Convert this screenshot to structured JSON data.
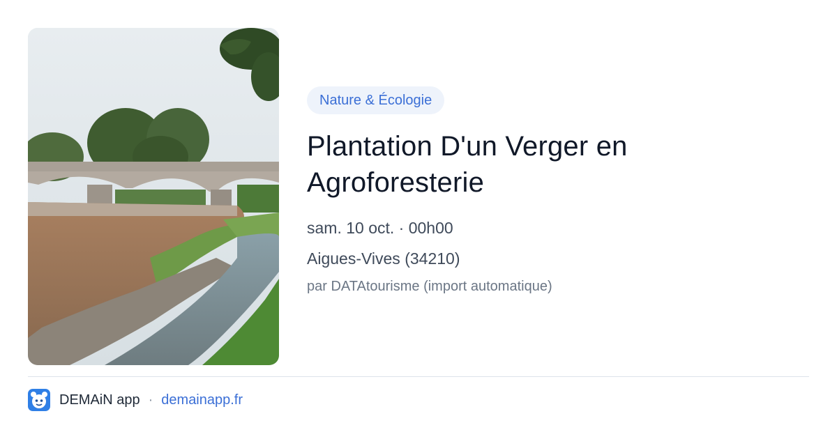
{
  "event": {
    "category": "Nature & Écologie",
    "title_line1": "Plantation D'un Verger en",
    "title_line2": "Agroforesterie",
    "datetime": "sam. 10 oct. · 00h00",
    "location": "Aigues-Vives (34210)",
    "author": "par DATAtourisme (import automatique)"
  },
  "footer": {
    "app_name": "DEMAiN app",
    "separator": "·",
    "site": "demainapp.fr"
  },
  "colors": {
    "accent": "#3b6fd6",
    "badge_bg": "#eef3fb",
    "logo_bg": "#2f7fe6"
  },
  "icons": {
    "app_logo": "demain-logo-icon"
  }
}
